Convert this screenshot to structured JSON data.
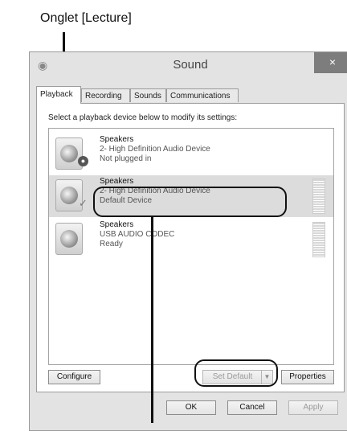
{
  "annotation": {
    "label": "Onglet [Lecture]"
  },
  "window": {
    "title": "Sound",
    "close_glyph": "×"
  },
  "tabs": [
    {
      "label": "Playback"
    },
    {
      "label": "Recording"
    },
    {
      "label": "Sounds"
    },
    {
      "label": "Communications"
    }
  ],
  "panel": {
    "instruction": "Select a playback device below to modify its settings:"
  },
  "devices": [
    {
      "name": "Speakers",
      "line1": "2- High Definition Audio Device",
      "line2": "Not plugged in",
      "badge": "unplugged-icon"
    },
    {
      "name": "Speakers",
      "line1": "2- High Definition Audio Device",
      "line2": "Default Device",
      "badge": "checkmark-icon"
    },
    {
      "name": "Speakers",
      "line1": "USB AUDIO  CODEC",
      "line2": "Ready",
      "badge": ""
    }
  ],
  "buttons": {
    "configure": "Configure",
    "set_default": "Set Default",
    "properties": "Properties",
    "ok": "OK",
    "cancel": "Cancel",
    "apply": "Apply"
  },
  "colors": {
    "annotation": "#111111",
    "selected_row": "#dcdcdc",
    "close_button": "#7d7d7d"
  }
}
